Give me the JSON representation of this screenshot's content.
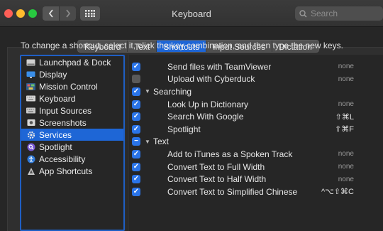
{
  "window": {
    "title": "Keyboard"
  },
  "toolbar": {
    "search_placeholder": "Search"
  },
  "tabs": [
    {
      "label": "Keyboard",
      "active": false
    },
    {
      "label": "Text",
      "active": false
    },
    {
      "label": "Shortcuts",
      "active": true
    },
    {
      "label": "Input Sources",
      "active": false
    },
    {
      "label": "Dictation",
      "active": false
    }
  ],
  "instructions": "To change a shortcut, select it, click the key combination, and then type the new keys.",
  "sidebar": {
    "items": [
      {
        "label": "Launchpad & Dock",
        "icon": "launchpad-icon"
      },
      {
        "label": "Display",
        "icon": "display-icon"
      },
      {
        "label": "Mission Control",
        "icon": "mission-control-icon"
      },
      {
        "label": "Keyboard",
        "icon": "keyboard-icon"
      },
      {
        "label": "Input Sources",
        "icon": "input-sources-icon"
      },
      {
        "label": "Screenshots",
        "icon": "screenshots-icon"
      },
      {
        "label": "Services",
        "icon": "gear-icon",
        "selected": true
      },
      {
        "label": "Spotlight",
        "icon": "spotlight-icon"
      },
      {
        "label": "Accessibility",
        "icon": "accessibility-icon"
      },
      {
        "label": "App Shortcuts",
        "icon": "app-shortcuts-icon"
      }
    ]
  },
  "shortcuts": {
    "rows": [
      {
        "label": "Send files with TeamViewer",
        "key": "none",
        "checked": "on",
        "group": false
      },
      {
        "label": "Upload with Cyberduck",
        "key": "none",
        "checked": "off",
        "group": false
      },
      {
        "label": "Searching",
        "key": "",
        "checked": "on",
        "group": true
      },
      {
        "label": "Look Up in Dictionary",
        "key": "none",
        "checked": "on",
        "group": false
      },
      {
        "label": "Search With Google",
        "key": "⇧⌘L",
        "checked": "on",
        "group": false
      },
      {
        "label": "Spotlight",
        "key": "⇧⌘F",
        "checked": "on",
        "group": false
      },
      {
        "label": "Text",
        "key": "",
        "checked": "mixed",
        "group": true
      },
      {
        "label": "Add to iTunes as a Spoken Track",
        "key": "none",
        "checked": "on",
        "group": false
      },
      {
        "label": "Convert Text to Full Width",
        "key": "none",
        "checked": "on",
        "group": false
      },
      {
        "label": "Convert Text to Half Width",
        "key": "none",
        "checked": "on",
        "group": false
      },
      {
        "label": "Convert Text to Simplified Chinese",
        "key": "^⌥⇧⌘C",
        "checked": "on",
        "group": false
      }
    ]
  }
}
